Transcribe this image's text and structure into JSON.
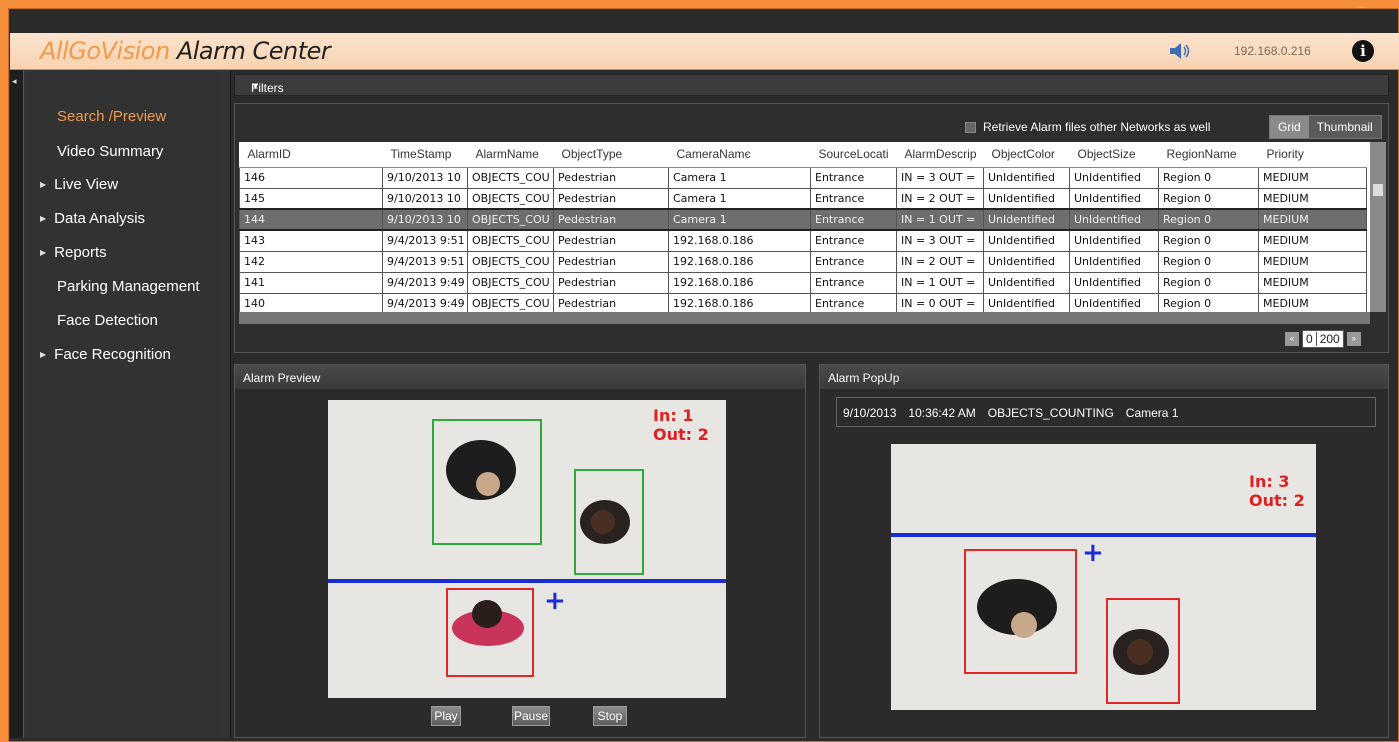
{
  "window": {
    "minimize": "–",
    "restore": "❐",
    "close": "✕"
  },
  "header": {
    "brand": "AllGoVision",
    "title_rest": " Alarm Center",
    "ip": "192.168.0.216",
    "speaker_icon": "speaker-icon",
    "info_icon": "info-icon"
  },
  "sidebar": {
    "items": [
      {
        "label": "Search /Preview",
        "active": true,
        "expandable": false
      },
      {
        "label": "Video Summary",
        "active": false,
        "expandable": false
      },
      {
        "label": "Live View",
        "active": false,
        "expandable": true
      },
      {
        "label": "Data Analysis",
        "active": false,
        "expandable": true
      },
      {
        "label": "Reports",
        "active": false,
        "expandable": true
      },
      {
        "label": "Parking Management",
        "active": false,
        "expandable": false
      },
      {
        "label": "Face Detection",
        "active": false,
        "expandable": false
      },
      {
        "label": "Face Recognition",
        "active": false,
        "expandable": true
      }
    ]
  },
  "filters": {
    "label": "Filters"
  },
  "grid": {
    "retrieve_label": "Retrieve Alarm files other Networks as well",
    "view_grid": "Grid",
    "view_thumbnail": "Thumbnail",
    "columns": [
      "AlarmID",
      "TimeStamp",
      "AlarmName",
      "ObjectType",
      "CameraNamє",
      "SourceLocati",
      "AlarmDescrip",
      "ObjectColor",
      "ObjectSize",
      "RegionName",
      "Priority"
    ],
    "rows": [
      [
        "146",
        "9/10/2013 10",
        "OBJECTS_COU",
        "Pedestrian",
        "Camera 1",
        "Entrance",
        "IN = 3 OUT =",
        "UnIdentified",
        "UnIdentified",
        "Region 0",
        "MEDIUM"
      ],
      [
        "145",
        "9/10/2013 10",
        "OBJECTS_COU",
        "Pedestrian",
        "Camera 1",
        "Entrance",
        "IN = 2 OUT =",
        "UnIdentified",
        "UnIdentified",
        "Region 0",
        "MEDIUM"
      ],
      [
        "144",
        "9/10/2013 10",
        "OBJECTS_COU",
        "Pedestrian",
        "Camera 1",
        "Entrance",
        "IN = 1 OUT =",
        "UnIdentified",
        "UnIdentified",
        "Region 0",
        "MEDIUM"
      ],
      [
        "143",
        "9/4/2013 9:51",
        "OBJECTS_COU",
        "Pedestrian",
        "192.168.0.186",
        "Entrance",
        "IN = 3 OUT =",
        "UnIdentified",
        "UnIdentified",
        "Region 0",
        "MEDIUM"
      ],
      [
        "142",
        "9/4/2013 9:51",
        "OBJECTS_COU",
        "Pedestrian",
        "192.168.0.186",
        "Entrance",
        "IN = 2 OUT =",
        "UnIdentified",
        "UnIdentified",
        "Region 0",
        "MEDIUM"
      ],
      [
        "141",
        "9/4/2013 9:49",
        "OBJECTS_COU",
        "Pedestrian",
        "192.168.0.186",
        "Entrance",
        "IN = 1 OUT =",
        "UnIdentified",
        "UnIdentified",
        "Region 0",
        "MEDIUM"
      ],
      [
        "140",
        "9/4/2013 9:49",
        "OBJECTS_COU",
        "Pedestrian",
        "192.168.0.186",
        "Entrance",
        "IN = 0 OUT =",
        "UnIdentified",
        "UnIdentified",
        "Region 0",
        "MEDIUM"
      ]
    ],
    "selected_row": 2,
    "pager": {
      "prev": "«",
      "next": "»",
      "page": "0",
      "total": "200"
    }
  },
  "preview": {
    "title": "Alarm Preview",
    "counts_in": "In: 1",
    "counts_out": "Out: 2",
    "play": "Play",
    "pause": "Pause",
    "stop": "Stop"
  },
  "popup": {
    "title": "Alarm PopUp",
    "date": "9/10/2013",
    "time": "10:36:42 AM",
    "alarm": "OBJECTS_COUNTING",
    "camera": "Camera 1",
    "counts_in": "In: 3",
    "counts_out": "Out: 2"
  },
  "colors": {
    "accent": "#f39a4a",
    "titlebar": "#f58f3c",
    "line": "#1a2bd8",
    "count_text": "#e02020",
    "box_green": "#2eaa3a",
    "box_red": "#e02828"
  }
}
